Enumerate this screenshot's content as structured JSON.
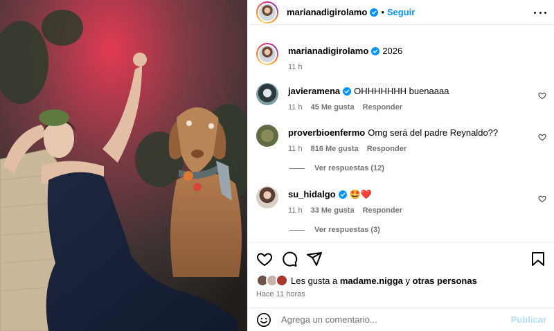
{
  "post": {
    "author": "marianadigirolamo",
    "follow_label": "Seguir",
    "separator": "•",
    "caption": "2026",
    "caption_time": "11 h"
  },
  "comments": [
    {
      "user": "javieramena",
      "verified": true,
      "text": "OHHHHHHH buenaaaa",
      "time": "11 h",
      "likes": "45 Me gusta",
      "reply_label": "Responder",
      "view_replies": ""
    },
    {
      "user": "proverbioenfermo",
      "verified": false,
      "text": "Omg será del padre Reynaldo??",
      "time": "11 h",
      "likes": "816 Me gusta",
      "reply_label": "Responder",
      "view_replies": "Ver respuestas (12)"
    },
    {
      "user": "su_hidalgo",
      "verified": true,
      "text": "🤩❤️",
      "time": "11 h",
      "likes": "33 Me gusta",
      "reply_label": "Responder",
      "view_replies": "Ver respuestas (3)"
    }
  ],
  "likes_bar": {
    "prefix": "Les gusta a",
    "liked_by": "madame.nigga",
    "connector": "y",
    "others": "otras personas"
  },
  "posted_ago": "Hace 11 horas",
  "composer": {
    "placeholder": "Agrega un comentario...",
    "publish_label": "Publicar"
  },
  "icons": {
    "verified": "verified-badge-icon",
    "like": "heart-icon",
    "comment": "comment-icon",
    "share": "share-icon",
    "save": "bookmark-icon",
    "emoji": "emoji-icon",
    "more": "more-options-icon"
  },
  "colors": {
    "accent": "#0095f6",
    "publish_disabled": "#b2dffc",
    "muted": "#737373",
    "heart_red": "#ed4956"
  }
}
